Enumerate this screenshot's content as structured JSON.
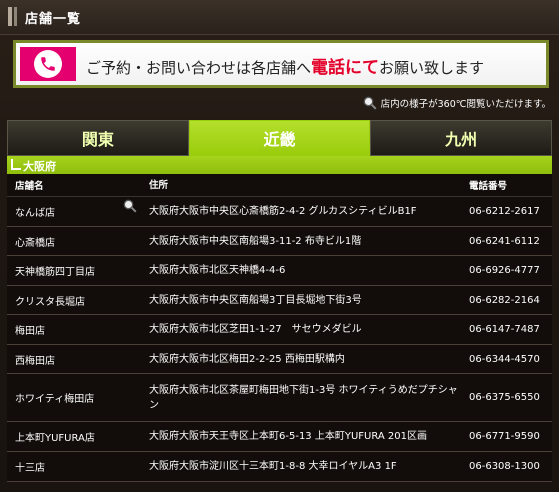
{
  "header": {
    "title": "店舗一覧"
  },
  "banner": {
    "text_before": "ご予約・お問い合わせは各店舗へ",
    "text_emphasis": "電話にて",
    "text_after": "お願い致します"
  },
  "note": {
    "text": "店内の様子が360℃閲覧いただけます。"
  },
  "tabs": [
    {
      "label": "関東",
      "active": false
    },
    {
      "label": "近畿",
      "active": true
    },
    {
      "label": "九州",
      "active": false
    }
  ],
  "section": {
    "label": "大阪府"
  },
  "table": {
    "headers": {
      "name": "店舗名",
      "address": "住所",
      "phone": "電話番号"
    },
    "rows": [
      {
        "name": "なんば店",
        "address": "大阪府大阪市中央区心斎橋筋2-4-2 グルカスシティビルB1F",
        "phone": "06-6212-2617",
        "has_360": true
      },
      {
        "name": "心斎橋店",
        "address": "大阪府大阪市中央区南船場3-11-2 布寺ビル1階",
        "phone": "06-6241-6112",
        "has_360": false
      },
      {
        "name": "天神橋筋四丁目店",
        "address": "大阪府大阪市北区天神橋4-4-6",
        "phone": "06-6926-4777",
        "has_360": false
      },
      {
        "name": "クリスタ長堀店",
        "address": "大阪府大阪市中央区南船場3丁目長堀地下街3号",
        "phone": "06-6282-2164",
        "has_360": false
      },
      {
        "name": "梅田店",
        "address": "大阪府大阪市北区芝田1-1-27　サセウメダビル",
        "phone": "06-6147-7487",
        "has_360": false
      },
      {
        "name": "西梅田店",
        "address": "大阪府大阪市北区梅田2-2-25 西梅田駅構内",
        "phone": "06-6344-4570",
        "has_360": false
      },
      {
        "name": "ホワイティ梅田店",
        "address": "大阪府大阪市北区茶屋町梅田地下街1-3号 ホワイティうめだプチシャン",
        "phone": "06-6375-6550",
        "has_360": false
      },
      {
        "name": "上本町YUFURA店",
        "address": "大阪府大阪市天王寺区上本町6-5-13 上本町YUFURA 201区画",
        "phone": "06-6771-9590",
        "has_360": false
      },
      {
        "name": "十三店",
        "address": "大阪府大阪市淀川区十三本町1-8-8 大幸ロイヤルA3 1F",
        "phone": "06-6308-1300",
        "has_360": false
      }
    ]
  },
  "colors": {
    "accent_green": "#9acd0c",
    "pink": "#e5006f",
    "red": "#e4002b"
  }
}
